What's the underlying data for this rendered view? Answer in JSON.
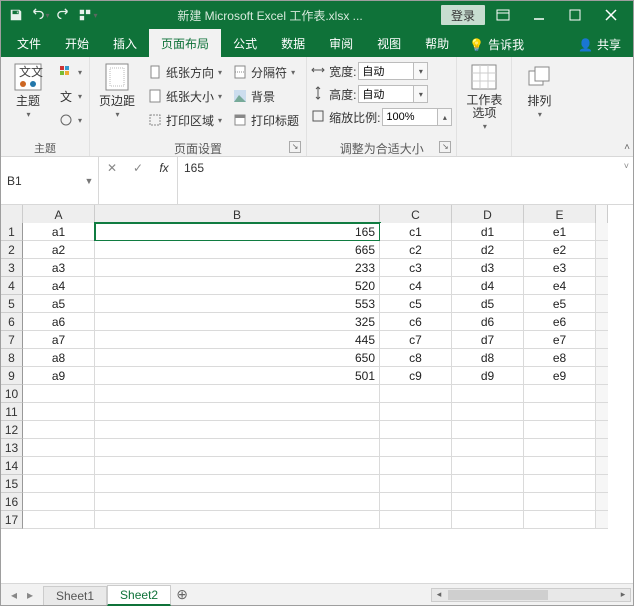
{
  "titlebar": {
    "filename": "新建 Microsoft Excel 工作表.xlsx  ...",
    "login": "登录"
  },
  "tabs": {
    "file": "文件",
    "home": "开始",
    "insert": "插入",
    "pagelayout": "页面布局",
    "formulas": "公式",
    "data": "数据",
    "review": "审阅",
    "view": "视图",
    "help": "帮助",
    "tellme": "告诉我",
    "share": "共享"
  },
  "ribbon": {
    "themes": {
      "theme": "主题",
      "group": "主题"
    },
    "pagesetup": {
      "margins": "页边距",
      "orientation": "纸张方向",
      "size": "纸张大小",
      "printarea": "打印区域",
      "breaks": "分隔符",
      "background": "背景",
      "titles": "打印标题",
      "group": "页面设置"
    },
    "scale": {
      "width": "宽度:",
      "height": "高度:",
      "scale": "缩放比例:",
      "width_val": "自动",
      "height_val": "自动",
      "scale_val": "100%",
      "group": "调整为合适大小"
    },
    "sheetopts": {
      "sheetoptions": "工作表选项"
    },
    "arrange": {
      "arrange": "排列"
    }
  },
  "namebox": "B1",
  "formula": "165",
  "columns": [
    "A",
    "B",
    "C",
    "D",
    "E"
  ],
  "data": [
    [
      "a1",
      "165",
      "c1",
      "d1",
      "e1"
    ],
    [
      "a2",
      "665",
      "c2",
      "d2",
      "e2"
    ],
    [
      "a3",
      "233",
      "c3",
      "d3",
      "e3"
    ],
    [
      "a4",
      "520",
      "c4",
      "d4",
      "e4"
    ],
    [
      "a5",
      "553",
      "c5",
      "d5",
      "e5"
    ],
    [
      "a6",
      "325",
      "c6",
      "d6",
      "e6"
    ],
    [
      "a7",
      "445",
      "c7",
      "d7",
      "e7"
    ],
    [
      "a8",
      "650",
      "c8",
      "d8",
      "e8"
    ],
    [
      "a9",
      "501",
      "c9",
      "d9",
      "e9"
    ]
  ],
  "sheets": {
    "s1": "Sheet1",
    "s2": "Sheet2"
  }
}
